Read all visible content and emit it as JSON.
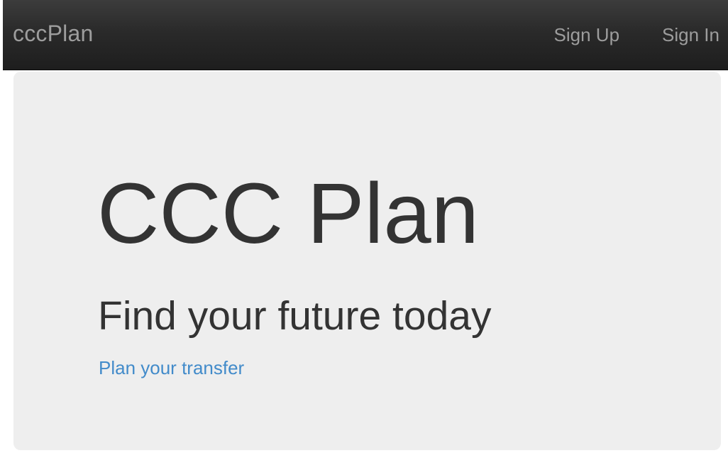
{
  "navbar": {
    "brand": "cccPlan",
    "links": [
      {
        "label": "Sign Up"
      },
      {
        "label": "Sign In"
      }
    ],
    "colors": {
      "background": "#222222",
      "text": "#9d9d9d"
    }
  },
  "hero": {
    "title": "CCC Plan",
    "subtitle": "Find your future today",
    "link_text": "Plan your transfer",
    "colors": {
      "background": "#eeeeee",
      "text": "#333333",
      "link": "#428bca"
    }
  }
}
